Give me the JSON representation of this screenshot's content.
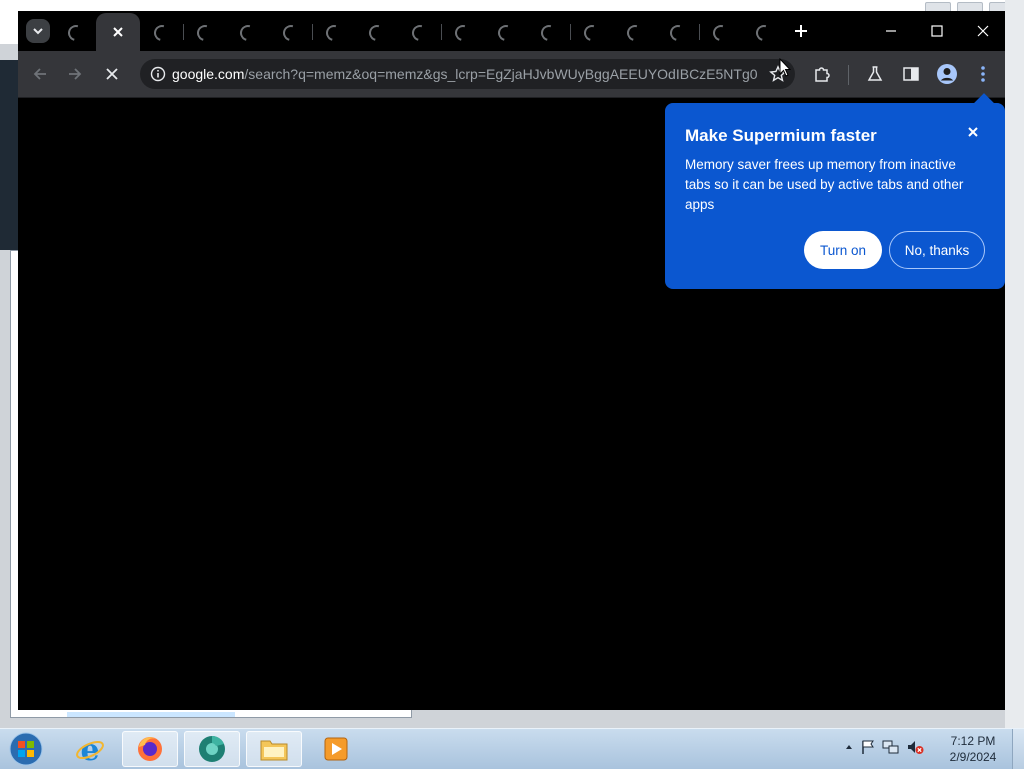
{
  "browser": {
    "tab_count_shown": 18,
    "address": {
      "host": "google.com",
      "path": "/search?q=memz&oq=memz&gs_lcrp=EgZjaHJvbWUyBggAEEUYOdIBCzE5NTg0..."
    },
    "icons": {
      "tab_search": "chevron-down-icon",
      "close_tab": "close-icon",
      "new_tab": "plus-icon",
      "back": "arrow-left-icon",
      "forward": "arrow-right-icon",
      "stop": "close-icon",
      "site_info": "info-icon",
      "bookmark": "star-icon",
      "extensions": "puzzle-icon",
      "labs": "flask-icon",
      "side_panel": "side-panel-icon",
      "profile": "avatar-icon",
      "menu": "kebab-menu-icon"
    }
  },
  "promo": {
    "title": "Make Supermium faster",
    "body": "Memory saver frees up memory from inactive tabs so it can be used by active tabs and other apps",
    "primary_label": "Turn on",
    "secondary_label": "No, thanks",
    "accent": "#0b57d0"
  },
  "taskbar": {
    "apps": [
      "internet-explorer-icon",
      "firefox-icon",
      "supermium-icon",
      "file-explorer-icon",
      "media-player-icon"
    ],
    "clock": {
      "time": "7:12 PM",
      "date": "2/9/2024"
    }
  }
}
